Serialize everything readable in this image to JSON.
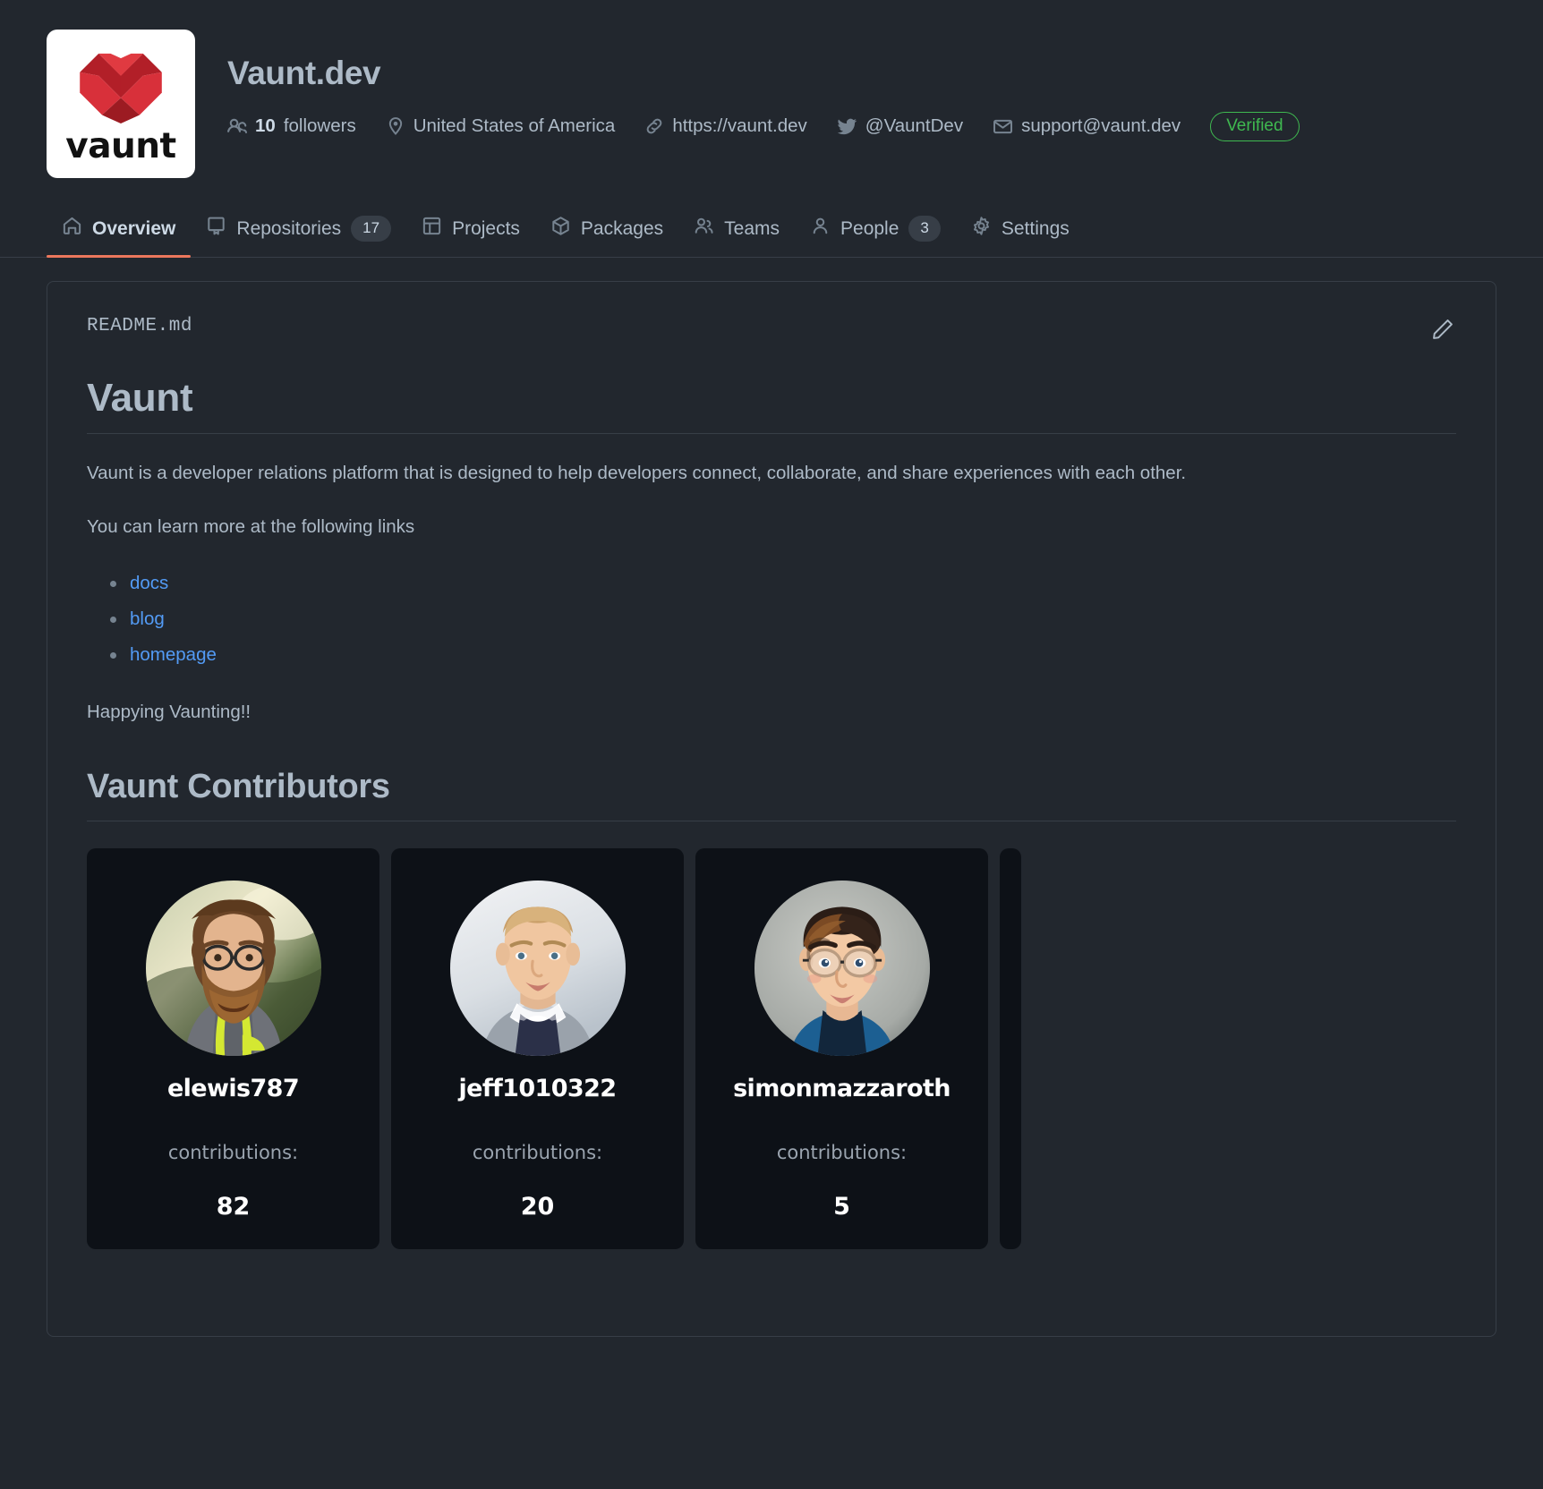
{
  "org": {
    "name": "Vaunt.dev",
    "logo_wordmark": "vaunt",
    "logo_color": "#c9252d",
    "meta": {
      "followers_count": "10",
      "followers_label": "followers",
      "location": "United States of America",
      "website": "https://vaunt.dev",
      "twitter": "@VauntDev",
      "email": "support@vaunt.dev",
      "verified_label": "Verified",
      "verified_color": "#3fb950"
    }
  },
  "nav": {
    "accent_color": "#ec775c",
    "tabs": [
      {
        "label": "Overview",
        "icon": "home-icon",
        "count": null,
        "active": true
      },
      {
        "label": "Repositories",
        "icon": "repo-icon",
        "count": "17",
        "active": false
      },
      {
        "label": "Projects",
        "icon": "project-board-icon",
        "count": null,
        "active": false
      },
      {
        "label": "Packages",
        "icon": "package-cube-icon",
        "count": null,
        "active": false
      },
      {
        "label": "Teams",
        "icon": "people-icon",
        "count": null,
        "active": false
      },
      {
        "label": "People",
        "icon": "person-icon",
        "count": "3",
        "active": false
      },
      {
        "label": "Settings",
        "icon": "gear-icon",
        "count": null,
        "active": false
      }
    ]
  },
  "readme": {
    "filename": "README.md",
    "edit_icon": "pencil-icon",
    "heading": "Vaunt",
    "paragraph_1": "Vaunt is a developer relations platform that is designed to help developers connect, collaborate, and share experiences with each other.",
    "paragraph_2": "You can learn more at the following links",
    "links": [
      {
        "label": "docs"
      },
      {
        "label": "blog"
      },
      {
        "label": "homepage"
      }
    ],
    "link_color": "#539bf5",
    "paragraph_3": "Happying Vaunting!!",
    "contributors_heading": "Vaunt Contributors",
    "contributions_label": "contributions:",
    "rule_color": "#e8262b",
    "contributors": [
      {
        "username": "elewis787",
        "contributions": "82",
        "avatar": "photo-bearded-man"
      },
      {
        "username": "jeff1010322",
        "contributions": "20",
        "avatar": "photo-short-hair-man"
      },
      {
        "username": "simonmazzaroth",
        "contributions": "5",
        "avatar": "illustration-glasses-man"
      }
    ]
  }
}
